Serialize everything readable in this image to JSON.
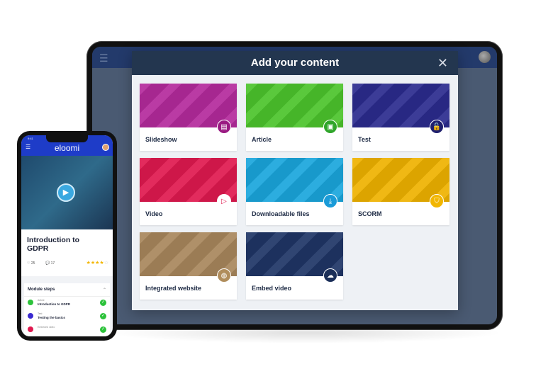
{
  "modal": {
    "title": "Add your content",
    "close_icon": "close-icon"
  },
  "content_types": [
    {
      "label": "Slideshow",
      "color": "#b42a9c",
      "icon_color": "#9a1a82",
      "icon": "document-icon",
      "glyph": "▤"
    },
    {
      "label": "Article",
      "color": "#4cc42c",
      "icon_color": "#2fa52a",
      "icon": "article-icon",
      "glyph": "▣"
    },
    {
      "label": "Test",
      "color": "#2b2b8e",
      "icon_color": "#1f1f6e",
      "icon": "lock-open-icon",
      "glyph": "🔓"
    },
    {
      "label": "Video",
      "color": "#e0194f",
      "icon_color": "#ffffff",
      "icon": "play-icon",
      "glyph": "▷"
    },
    {
      "label": "Downloadable files",
      "color": "#1aa6dc",
      "icon_color": "#1a9bd8",
      "icon": "download-icon",
      "glyph": "⤓"
    },
    {
      "label": "SCORM",
      "color": "#efb200",
      "icon_color": "#f2b600",
      "icon": "scorm-icon",
      "glyph": "⛉"
    },
    {
      "label": "Integrated website",
      "color": "#a8875c",
      "icon_color": "#b08d5c",
      "icon": "globe-icon",
      "glyph": "◍"
    },
    {
      "label": "Embed video",
      "color": "#1f3566",
      "icon_color": "#1a2e58",
      "icon": "cloud-upload-icon",
      "glyph": "☁"
    }
  ],
  "phone": {
    "time": "9:41",
    "logo": "eloomi",
    "course_title": "Introduction to GDPR",
    "likes": "25",
    "comments": "17",
    "rating": 4,
    "steps_title": "Module steps",
    "steps": [
      {
        "type": "Article",
        "name": "Introduction to GDPR",
        "color": "#2cc23a"
      },
      {
        "type": "Test",
        "name": "Testing the basics",
        "color": "#3a2ad0"
      },
      {
        "type": "Embeded video",
        "name": "",
        "color": "#e0194f"
      }
    ]
  }
}
